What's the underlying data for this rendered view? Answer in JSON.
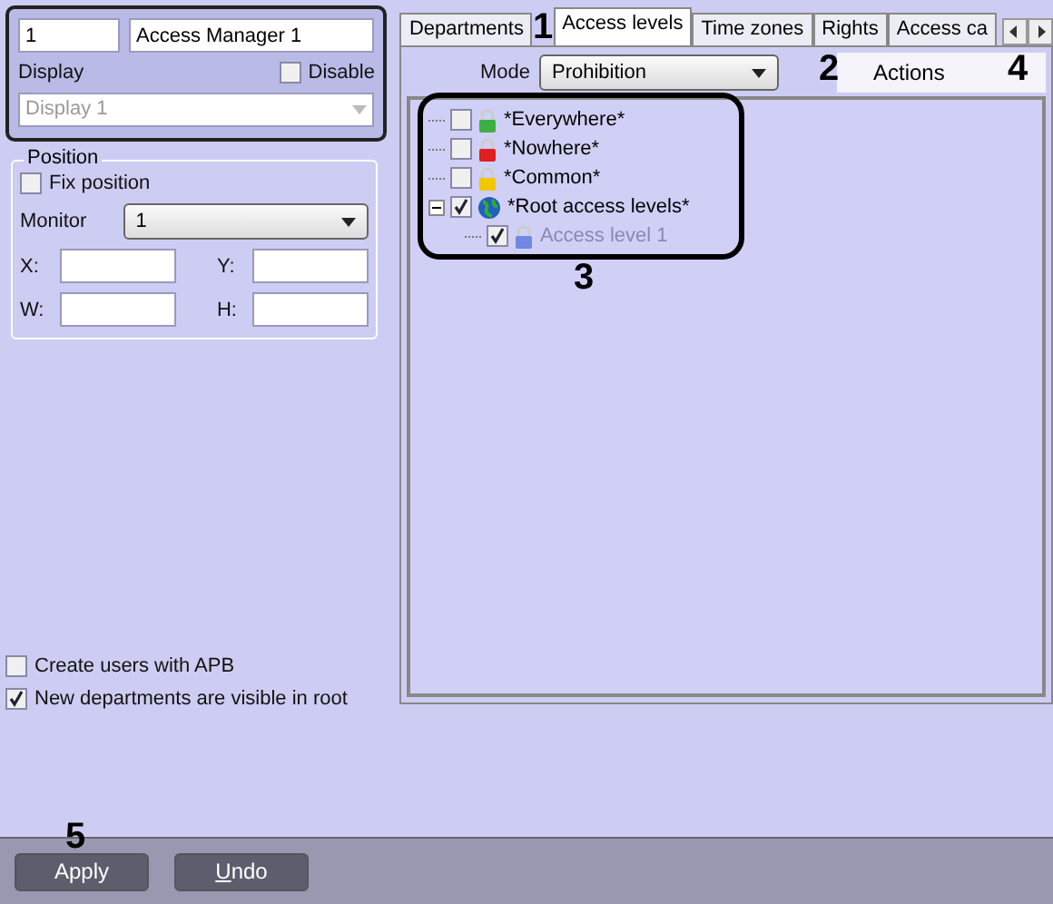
{
  "header": {
    "number": "1",
    "name": "Access Manager 1",
    "display_label": "Display",
    "disable": {
      "label": "Disable",
      "checked": false
    },
    "display_value": "Display 1"
  },
  "position": {
    "title": "Position",
    "fix": {
      "label": "Fix position",
      "checked": false
    },
    "monitor_label": "Monitor",
    "monitor_value": "1",
    "x_label": "X:",
    "y_label": "Y:",
    "w_label": "W:",
    "h_label": "H:"
  },
  "options": [
    {
      "label": "Create users with APB",
      "checked": false
    },
    {
      "label": "New departments are visible in root",
      "checked": true
    }
  ],
  "tabs": [
    {
      "label": "Departments",
      "selected": false
    },
    {
      "label": "Access levels",
      "selected": true
    },
    {
      "label": "Time zones",
      "selected": false
    },
    {
      "label": "Rights",
      "selected": false
    },
    {
      "label": "Access ca",
      "selected": false
    }
  ],
  "mode": {
    "label": "Mode",
    "value": "Prohibition"
  },
  "actions": "Actions",
  "tree": [
    {
      "label": "*Everywhere*",
      "checked": false,
      "kind": "lock",
      "color": "#3cb043",
      "disabled": false
    },
    {
      "label": "*Nowhere*",
      "checked": false,
      "kind": "lock",
      "color": "#e02020",
      "disabled": false
    },
    {
      "label": "*Common*",
      "checked": false,
      "kind": "lock",
      "color": "#f0c800",
      "disabled": false
    },
    {
      "label": "*Root access levels*",
      "checked": true,
      "kind": "globe",
      "color": "#2060c0",
      "disabled": false,
      "expanded": true,
      "children": [
        {
          "label": "Access level 1",
          "checked": true,
          "kind": "lock",
          "color": "#7088e0",
          "disabled": true
        }
      ]
    }
  ],
  "buttons": [
    "Apply",
    "Undo"
  ],
  "callouts": [
    "1",
    "2",
    "3",
    "4",
    "5"
  ]
}
